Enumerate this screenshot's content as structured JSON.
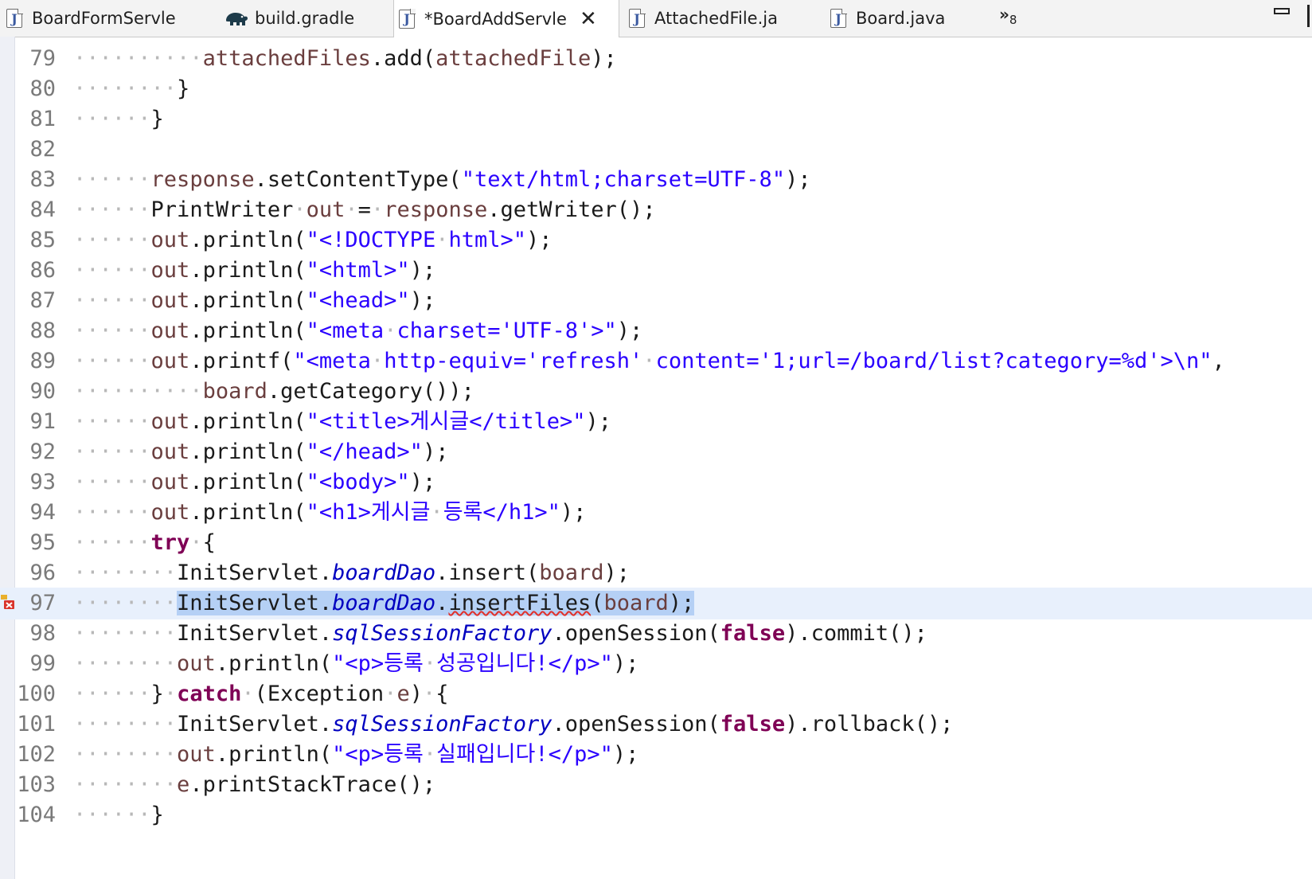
{
  "tabs": [
    {
      "label": "BoardFormServle",
      "icon": "java-file-icon",
      "active": false
    },
    {
      "label": "build.gradle",
      "icon": "gradle-elephant-icon",
      "active": false
    },
    {
      "label": "*BoardAddServle",
      "icon": "java-file-icon",
      "active": true
    },
    {
      "label": "AttachedFile.ja",
      "icon": "java-file-icon",
      "active": false
    },
    {
      "label": "Board.java",
      "icon": "java-file-icon",
      "active": false
    }
  ],
  "tab_overflow": {
    "glyph": "»",
    "count": "8"
  },
  "current_line": 97,
  "error_line": 97,
  "lines": [
    {
      "n": "79",
      "tokens": [
        [
          "ws",
          "··········"
        ],
        [
          "var",
          "attachedFiles"
        ],
        [
          "plain",
          ".add("
        ],
        [
          "var",
          "attachedFile"
        ],
        [
          "plain",
          ");"
        ]
      ]
    },
    {
      "n": "80",
      "tokens": [
        [
          "ws",
          "········"
        ],
        [
          "plain",
          "}"
        ]
      ]
    },
    {
      "n": "81",
      "tokens": [
        [
          "ws",
          "······"
        ],
        [
          "plain",
          "}"
        ]
      ]
    },
    {
      "n": "82",
      "tokens": []
    },
    {
      "n": "83",
      "tokens": [
        [
          "ws",
          "······"
        ],
        [
          "var",
          "response"
        ],
        [
          "plain",
          ".setContentType("
        ],
        [
          "str",
          "\"text/html;charset=UTF-8\""
        ],
        [
          "plain",
          ");"
        ]
      ]
    },
    {
      "n": "84",
      "tokens": [
        [
          "ws",
          "······"
        ],
        [
          "plain",
          "PrintWriter"
        ],
        [
          "ws",
          "·"
        ],
        [
          "var",
          "out"
        ],
        [
          "ws",
          "·"
        ],
        [
          "plain",
          "="
        ],
        [
          "ws",
          "·"
        ],
        [
          "var",
          "response"
        ],
        [
          "plain",
          ".getWriter();"
        ]
      ]
    },
    {
      "n": "85",
      "tokens": [
        [
          "ws",
          "······"
        ],
        [
          "var",
          "out"
        ],
        [
          "plain",
          ".println("
        ],
        [
          "str",
          "\"<!DOCTYPE"
        ],
        [
          "ws",
          "·"
        ],
        [
          "str",
          "html>\""
        ],
        [
          "plain",
          ");"
        ]
      ]
    },
    {
      "n": "86",
      "tokens": [
        [
          "ws",
          "······"
        ],
        [
          "var",
          "out"
        ],
        [
          "plain",
          ".println("
        ],
        [
          "str",
          "\"<html>\""
        ],
        [
          "plain",
          ");"
        ]
      ]
    },
    {
      "n": "87",
      "tokens": [
        [
          "ws",
          "······"
        ],
        [
          "var",
          "out"
        ],
        [
          "plain",
          ".println("
        ],
        [
          "str",
          "\"<head>\""
        ],
        [
          "plain",
          ");"
        ]
      ]
    },
    {
      "n": "88",
      "tokens": [
        [
          "ws",
          "······"
        ],
        [
          "var",
          "out"
        ],
        [
          "plain",
          ".println("
        ],
        [
          "str",
          "\"<meta"
        ],
        [
          "ws",
          "·"
        ],
        [
          "str",
          "charset='UTF-8'>\""
        ],
        [
          "plain",
          ");"
        ]
      ]
    },
    {
      "n": "89",
      "tokens": [
        [
          "ws",
          "······"
        ],
        [
          "var",
          "out"
        ],
        [
          "plain",
          ".printf("
        ],
        [
          "str",
          "\"<meta"
        ],
        [
          "ws",
          "·"
        ],
        [
          "str",
          "http-equiv='refresh'"
        ],
        [
          "ws",
          "·"
        ],
        [
          "str",
          "content='1;url=/board/list?category=%d'>\\n\""
        ],
        [
          "plain",
          ","
        ]
      ]
    },
    {
      "n": "90",
      "tokens": [
        [
          "ws",
          "··········"
        ],
        [
          "var",
          "board"
        ],
        [
          "plain",
          ".getCategory());"
        ]
      ]
    },
    {
      "n": "91",
      "tokens": [
        [
          "ws",
          "······"
        ],
        [
          "var",
          "out"
        ],
        [
          "plain",
          ".println("
        ],
        [
          "str",
          "\"<title>게시글</title>\""
        ],
        [
          "plain",
          ");"
        ]
      ]
    },
    {
      "n": "92",
      "tokens": [
        [
          "ws",
          "······"
        ],
        [
          "var",
          "out"
        ],
        [
          "plain",
          ".println("
        ],
        [
          "str",
          "\"</head>\""
        ],
        [
          "plain",
          ");"
        ]
      ]
    },
    {
      "n": "93",
      "tokens": [
        [
          "ws",
          "······"
        ],
        [
          "var",
          "out"
        ],
        [
          "plain",
          ".println("
        ],
        [
          "str",
          "\"<body>\""
        ],
        [
          "plain",
          ");"
        ]
      ]
    },
    {
      "n": "94",
      "tokens": [
        [
          "ws",
          "······"
        ],
        [
          "var",
          "out"
        ],
        [
          "plain",
          ".println("
        ],
        [
          "str",
          "\"<h1>게시글"
        ],
        [
          "ws",
          "·"
        ],
        [
          "str",
          "등록</h1>\""
        ],
        [
          "plain",
          ");"
        ]
      ]
    },
    {
      "n": "95",
      "tokens": [
        [
          "ws",
          "······"
        ],
        [
          "kw",
          "try"
        ],
        [
          "ws",
          "·"
        ],
        [
          "plain",
          "{"
        ]
      ]
    },
    {
      "n": "96",
      "tokens": [
        [
          "ws",
          "········"
        ],
        [
          "plain",
          "InitServlet."
        ],
        [
          "static",
          "boardDao"
        ],
        [
          "plain",
          ".insert("
        ],
        [
          "var",
          "board"
        ],
        [
          "plain",
          ");"
        ]
      ]
    },
    {
      "n": "97",
      "tokens": [
        [
          "ws",
          "········"
        ],
        [
          "sel",
          "InitServlet."
        ],
        [
          "selstatic",
          "boardDao"
        ],
        [
          "sel",
          "."
        ],
        [
          "selerr",
          "insertFiles"
        ],
        [
          "sel",
          "("
        ],
        [
          "selvar",
          "board"
        ],
        [
          "sel",
          ");"
        ]
      ]
    },
    {
      "n": "98",
      "tokens": [
        [
          "ws",
          "········"
        ],
        [
          "plain",
          "InitServlet."
        ],
        [
          "static",
          "sqlSessionFactory"
        ],
        [
          "plain",
          ".openSession("
        ],
        [
          "kw",
          "false"
        ],
        [
          "plain",
          ").commit();"
        ]
      ]
    },
    {
      "n": "99",
      "tokens": [
        [
          "ws",
          "········"
        ],
        [
          "var",
          "out"
        ],
        [
          "plain",
          ".println("
        ],
        [
          "str",
          "\"<p>등록"
        ],
        [
          "ws",
          "·"
        ],
        [
          "str",
          "성공입니다!</p>\""
        ],
        [
          "plain",
          ");"
        ]
      ]
    },
    {
      "n": "100",
      "tokens": [
        [
          "ws",
          "······"
        ],
        [
          "plain",
          "}"
        ],
        [
          "ws",
          "·"
        ],
        [
          "kw",
          "catch"
        ],
        [
          "ws",
          "·"
        ],
        [
          "plain",
          "(Exception"
        ],
        [
          "ws",
          "·"
        ],
        [
          "var",
          "e"
        ],
        [
          "plain",
          ")"
        ],
        [
          "ws",
          "·"
        ],
        [
          "plain",
          "{"
        ]
      ]
    },
    {
      "n": "101",
      "tokens": [
        [
          "ws",
          "········"
        ],
        [
          "plain",
          "InitServlet."
        ],
        [
          "static",
          "sqlSessionFactory"
        ],
        [
          "plain",
          ".openSession("
        ],
        [
          "kw",
          "false"
        ],
        [
          "plain",
          ").rollback();"
        ]
      ]
    },
    {
      "n": "102",
      "tokens": [
        [
          "ws",
          "········"
        ],
        [
          "var",
          "out"
        ],
        [
          "plain",
          ".println("
        ],
        [
          "str",
          "\"<p>등록"
        ],
        [
          "ws",
          "·"
        ],
        [
          "str",
          "실패입니다!</p>\""
        ],
        [
          "plain",
          ");"
        ]
      ]
    },
    {
      "n": "103",
      "tokens": [
        [
          "ws",
          "········"
        ],
        [
          "var",
          "e"
        ],
        [
          "plain",
          ".printStackTrace();"
        ]
      ]
    },
    {
      "n": "104",
      "tokens": [
        [
          "ws",
          "······"
        ],
        [
          "plain",
          "}"
        ]
      ]
    }
  ],
  "colors": {
    "keyword": "#7f0055",
    "string": "#2a00ff",
    "variable": "#6a3e3e",
    "static_field": "#0000c0",
    "current_line_bg": "#e8f0fc",
    "selection_bg": "#b5d0f5",
    "error_underline": "#e0302a"
  }
}
